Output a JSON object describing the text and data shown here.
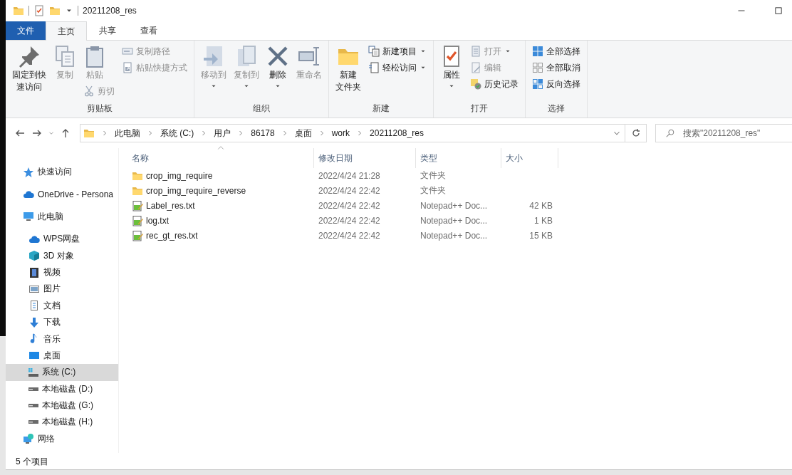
{
  "window": {
    "title": "20211208_res"
  },
  "ribbon_tabs": [
    {
      "label": "文件",
      "kind": "file",
      "selected": false
    },
    {
      "label": "主页",
      "kind": "tab",
      "selected": true
    },
    {
      "label": "共享",
      "kind": "tab",
      "selected": false
    },
    {
      "label": "查看",
      "kind": "tab",
      "selected": false
    }
  ],
  "ribbon_groups": [
    {
      "label": "剪贴板",
      "columns": [
        [
          {
            "lines": [
              "固定到快",
              "速访问"
            ],
            "kind": "large",
            "disabled": false,
            "dropdown": false
          }
        ],
        [
          {
            "lines": [
              "复制"
            ],
            "kind": "large",
            "disabled": true,
            "dropdown": false
          }
        ],
        [
          {
            "lines": [
              "粘贴"
            ],
            "kind": "large",
            "disabled": true,
            "dropdown": false
          },
          {
            "label": "剪切",
            "kind": "small",
            "disabled": true,
            "dropdown": false
          }
        ],
        [
          {
            "label": "复制路径",
            "kind": "small",
            "disabled": true,
            "dropdown": false
          },
          {
            "label": "粘贴快捷方式",
            "kind": "small",
            "disabled": true,
            "dropdown": false
          }
        ]
      ]
    },
    {
      "label": "组织",
      "columns": [
        [
          {
            "lines": [
              "移动到"
            ],
            "kind": "large",
            "disabled": true,
            "dropdown": true
          }
        ],
        [
          {
            "lines": [
              "复制到"
            ],
            "kind": "large",
            "disabled": true,
            "dropdown": true
          }
        ],
        [
          {
            "lines": [
              "删除"
            ],
            "kind": "large",
            "disabled": false,
            "dropdown": true
          }
        ],
        [
          {
            "lines": [
              "重命名"
            ],
            "kind": "large",
            "disabled": true,
            "dropdown": false
          }
        ]
      ]
    },
    {
      "label": "新建",
      "columns": [
        [
          {
            "lines": [
              "新建",
              "文件夹"
            ],
            "kind": "large",
            "disabled": false,
            "dropdown": false
          }
        ],
        [
          {
            "label": "新建项目",
            "kind": "small",
            "disabled": false,
            "dropdown": true
          },
          {
            "label": "轻松访问",
            "kind": "small",
            "disabled": false,
            "dropdown": true
          }
        ]
      ]
    },
    {
      "label": "打开",
      "columns": [
        [
          {
            "lines": [
              "属性"
            ],
            "kind": "large",
            "disabled": false,
            "dropdown": true
          }
        ],
        [
          {
            "label": "打开",
            "kind": "small",
            "disabled": true,
            "dropdown": true
          },
          {
            "label": "编辑",
            "kind": "small",
            "disabled": true,
            "dropdown": false
          },
          {
            "label": "历史记录",
            "kind": "small",
            "disabled": false,
            "dropdown": false
          }
        ]
      ]
    },
    {
      "label": "选择",
      "columns": [
        [
          {
            "label": "全部选择",
            "kind": "small",
            "disabled": false,
            "dropdown": false
          },
          {
            "label": "全部取消",
            "kind": "small",
            "disabled": false,
            "dropdown": false
          },
          {
            "label": "反向选择",
            "kind": "small",
            "disabled": false,
            "dropdown": false
          }
        ]
      ]
    }
  ],
  "address": {
    "breadcrumbs": [
      "此电脑",
      "系统 (C:)",
      "用户",
      "86178",
      "桌面",
      "work",
      "20211208_res"
    ]
  },
  "search": {
    "placeholder": "搜索\"20211208_res\""
  },
  "sidebar": {
    "items": [
      {
        "label": "快速访问",
        "selected": false
      },
      {
        "label": "OneDrive - Persona",
        "selected": false
      },
      {
        "label": "此电脑",
        "selected": false,
        "children": [
          {
            "label": "WPS网盘",
            "selected": false
          },
          {
            "label": "3D 对象",
            "selected": false
          },
          {
            "label": "视频",
            "selected": false
          },
          {
            "label": "图片",
            "selected": false
          },
          {
            "label": "文档",
            "selected": false
          },
          {
            "label": "下载",
            "selected": false
          },
          {
            "label": "音乐",
            "selected": false
          },
          {
            "label": "桌面",
            "selected": false
          },
          {
            "label": "系统 (C:)",
            "selected": true
          },
          {
            "label": "本地磁盘 (D:)",
            "selected": false
          },
          {
            "label": "本地磁盘 (G:)",
            "selected": false
          },
          {
            "label": "本地磁盘 (H:)",
            "selected": false
          }
        ]
      },
      {
        "label": "网络",
        "selected": false
      }
    ]
  },
  "table": {
    "columns": [
      {
        "label": "名称",
        "sorted": true
      },
      {
        "label": "修改日期",
        "sorted": false
      },
      {
        "label": "类型",
        "sorted": false
      },
      {
        "label": "大小",
        "sorted": false
      }
    ],
    "rows": [
      {
        "kind": "folder",
        "name": "crop_img_require",
        "date": "2022/4/24 21:28",
        "type": "文件夹"
      },
      {
        "kind": "folder",
        "name": "crop_img_require_reverse",
        "date": "2022/4/24 22:42",
        "type": "文件夹"
      },
      {
        "kind": "text",
        "name": "Label_res.txt",
        "date": "2022/4/24 22:42",
        "type": "Notepad++ Doc...",
        "size": "42 KB"
      },
      {
        "kind": "text",
        "name": "log.txt",
        "date": "2022/4/24 22:42",
        "type": "Notepad++ Doc...",
        "size": "1 KB"
      },
      {
        "kind": "text",
        "name": "rec_gt_res.txt",
        "date": "2022/4/24 22:42",
        "type": "Notepad++ Doc...",
        "size": "15 KB"
      }
    ]
  },
  "status_bar": {
    "count": "5 个项目"
  }
}
